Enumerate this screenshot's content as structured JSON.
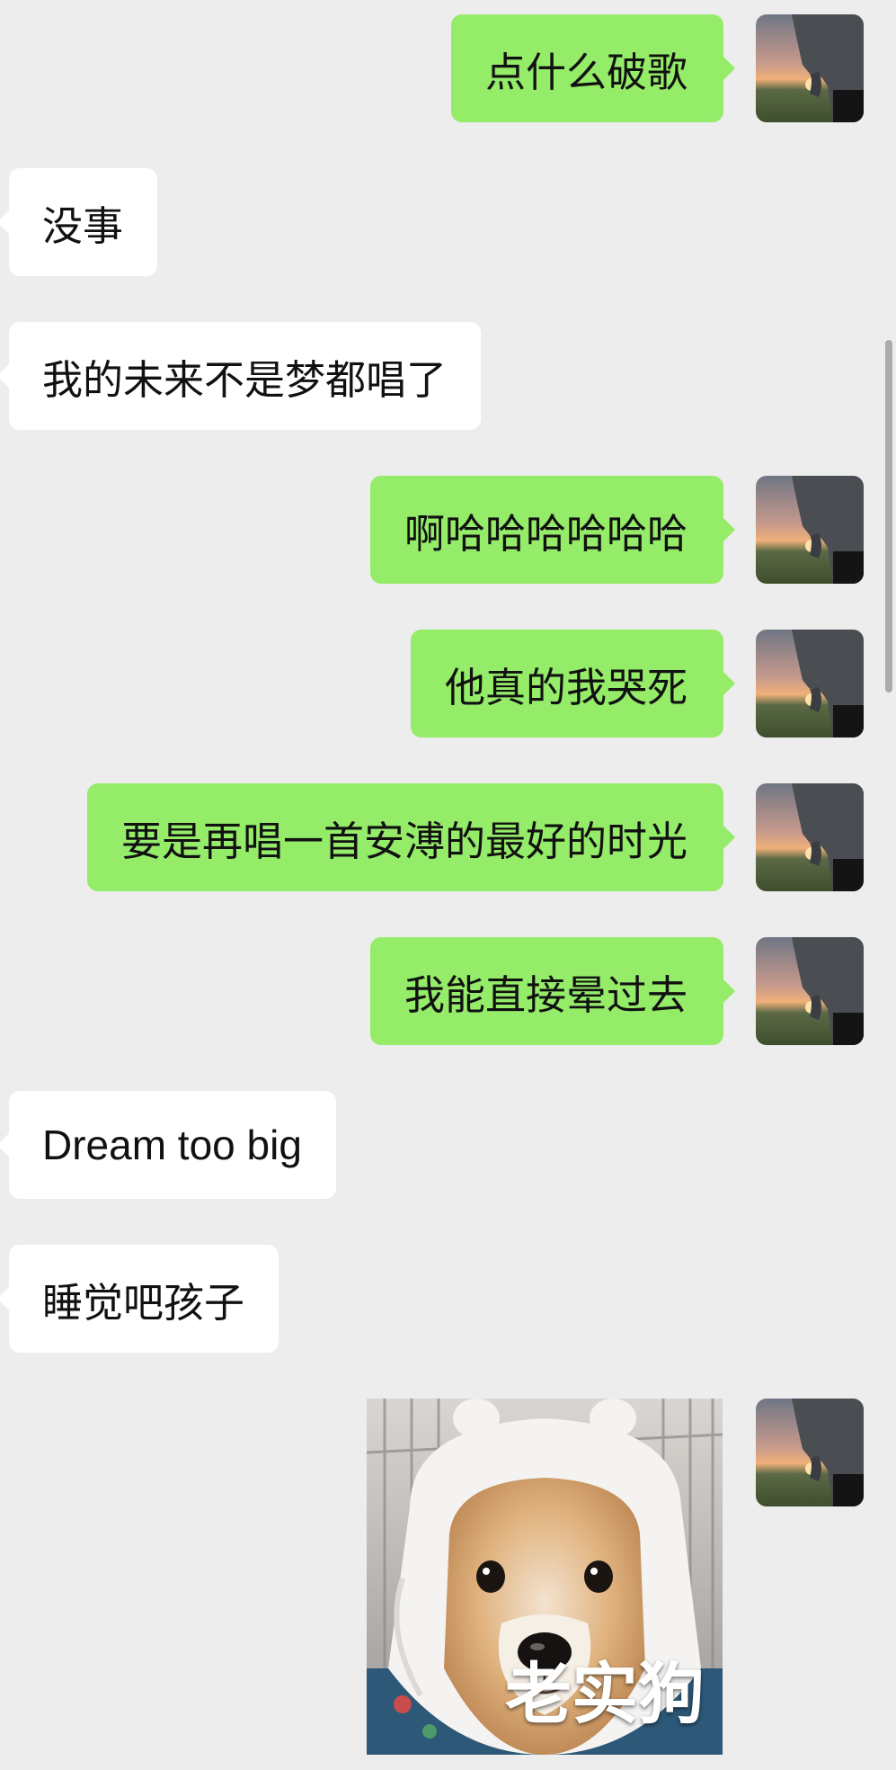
{
  "messages": [
    {
      "from": "me",
      "text": "点什么破歌"
    },
    {
      "from": "them",
      "text": "没事"
    },
    {
      "from": "them",
      "text": "我的未来不是梦都唱了"
    },
    {
      "from": "me",
      "text": "啊哈哈哈哈哈哈"
    },
    {
      "from": "me",
      "text": "他真的我哭死"
    },
    {
      "from": "me",
      "text": "要是再唱一首安溥的最好的时光"
    },
    {
      "from": "me",
      "text": "我能直接晕过去"
    },
    {
      "from": "them",
      "text": "Dream too big"
    },
    {
      "from": "them",
      "text": "睡觉吧孩子"
    },
    {
      "from": "me",
      "type": "sticker",
      "caption": "老实狗"
    }
  ],
  "colors": {
    "background": "#ededed",
    "my_bubble": "#95ec69",
    "their_bubble": "#ffffff",
    "text": "#111111"
  },
  "icons": {
    "avatar": "user-avatar-sunset-photo",
    "sticker": "shiba-dog-in-white-hood"
  }
}
